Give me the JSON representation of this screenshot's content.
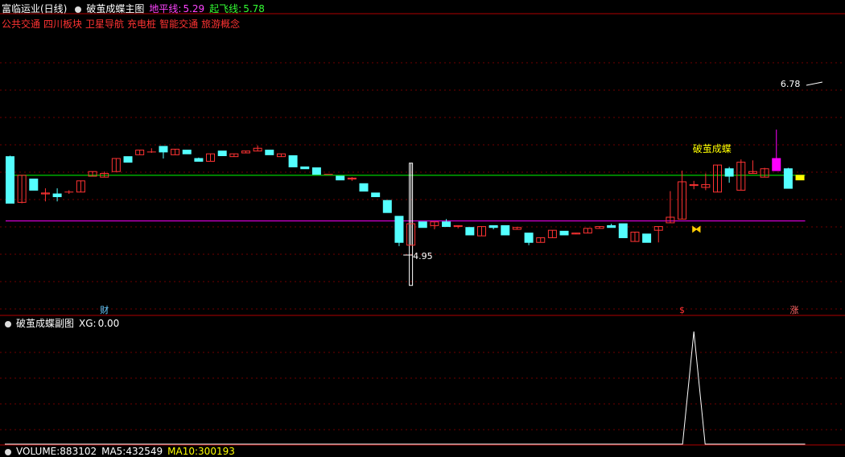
{
  "window": {
    "stock_title": "富临运业(日线)",
    "main_indicator": "破茧成蝶主图",
    "ground_line_label": "地平线:",
    "ground_line_value": "5.29",
    "takeoff_line_label": "起飞线:",
    "takeoff_line_value": "5.78"
  },
  "concepts": [
    "公共交通",
    "四川板块",
    "卫星导航",
    "充电桩",
    "智能交通",
    "旅游概念"
  ],
  "sub_panel": {
    "indicator": "破茧成蝶副图",
    "xg_label": "XG:",
    "xg_value": "0.00"
  },
  "volume_panel": {
    "volume_label": "VOLUME:",
    "volume_value": "883102",
    "ma5_label": "MA5:",
    "ma5_value": "432549",
    "ma10_label": "MA10:",
    "ma10_value": "300193"
  },
  "markers": {
    "cai": "财",
    "dollar": "$",
    "zhang": "涨"
  },
  "colors": {
    "background": "#000000",
    "up": "#ff3333",
    "down": "#54ffff",
    "ground_line": "#ff00ff",
    "takeoff_line": "#00ff00",
    "highlight_up": "#ff00ff",
    "highlight_last": "#ffff00",
    "annotation": "#ffff00",
    "panel_border": "#b00000"
  },
  "chart_data": {
    "type": "candlestick",
    "max_label": "6.78",
    "min_label": "4.95",
    "max_value": 6.78,
    "min_value": 4.95,
    "ground_line": 5.29,
    "takeoff_line": 5.78,
    "annotation_text": "破茧成蝶",
    "candles": [
      [
        5.98,
        5.48,
        5.99,
        5.48
      ],
      [
        5.49,
        5.78,
        5.78,
        5.48
      ],
      [
        5.74,
        5.62,
        5.74,
        5.62
      ],
      [
        5.58,
        5.59,
        5.64,
        5.5
      ],
      [
        5.58,
        5.55,
        5.64,
        5.5
      ],
      [
        5.6,
        5.6,
        5.62,
        5.58
      ],
      [
        5.6,
        5.72,
        5.72,
        5.6
      ],
      [
        5.77,
        5.82,
        5.82,
        5.77
      ],
      [
        5.76,
        5.8,
        5.82,
        5.76
      ],
      [
        5.82,
        5.96,
        5.96,
        5.82
      ],
      [
        5.98,
        5.92,
        5.98,
        5.92
      ],
      [
        6.0,
        6.05,
        6.05,
        6.0
      ],
      [
        6.03,
        6.03,
        6.07,
        6.02
      ],
      [
        6.09,
        6.03,
        6.09,
        5.96
      ],
      [
        6.0,
        6.06,
        6.06,
        6.0
      ],
      [
        6.05,
        6.01,
        6.05,
        6.01
      ],
      [
        5.96,
        5.93,
        5.97,
        5.93
      ],
      [
        5.93,
        6.01,
        6.01,
        5.93
      ],
      [
        6.04,
        5.99,
        6.04,
        5.99
      ],
      [
        5.98,
        6.01,
        6.01,
        5.98
      ],
      [
        6.02,
        6.04,
        6.04,
        6.02
      ],
      [
        6.04,
        6.07,
        6.1,
        6.04
      ],
      [
        6.05,
        6.0,
        6.05,
        6.0
      ],
      [
        5.98,
        6.01,
        6.01,
        5.98
      ],
      [
        5.99,
        5.87,
        5.99,
        5.87
      ],
      [
        5.87,
        5.85,
        5.87,
        5.85
      ],
      [
        5.86,
        5.79,
        5.86,
        5.79
      ],
      [
        5.79,
        5.79,
        5.79,
        5.79
      ],
      [
        5.77,
        5.73,
        5.77,
        5.73
      ],
      [
        5.74,
        5.75,
        5.76,
        5.72
      ],
      [
        5.69,
        5.61,
        5.69,
        5.61
      ],
      [
        5.59,
        5.55,
        5.59,
        5.55
      ],
      [
        5.51,
        5.38,
        5.51,
        5.38
      ],
      [
        5.34,
        5.06,
        5.34,
        5.02
      ],
      [
        5.03,
        5.26,
        5.91,
        5.03
      ],
      [
        5.28,
        5.22,
        5.28,
        5.22
      ],
      [
        5.24,
        5.28,
        5.28,
        5.2
      ],
      [
        5.28,
        5.23,
        5.31,
        5.23
      ],
      [
        5.23,
        5.24,
        5.24,
        5.21
      ],
      [
        5.22,
        5.14,
        5.22,
        5.14
      ],
      [
        5.13,
        5.23,
        5.23,
        5.13
      ],
      [
        5.24,
        5.22,
        5.24,
        5.2
      ],
      [
        5.24,
        5.14,
        5.24,
        5.14
      ],
      [
        5.2,
        5.22,
        5.22,
        5.2
      ],
      [
        5.16,
        5.06,
        5.16,
        5.03
      ],
      [
        5.06,
        5.11,
        5.11,
        5.06
      ],
      [
        5.11,
        5.19,
        5.19,
        5.11
      ],
      [
        5.18,
        5.14,
        5.18,
        5.14
      ],
      [
        5.15,
        5.16,
        5.16,
        5.15
      ],
      [
        5.16,
        5.21,
        5.21,
        5.16
      ],
      [
        5.21,
        5.23,
        5.23,
        5.21
      ],
      [
        5.24,
        5.22,
        5.26,
        5.22
      ],
      [
        5.26,
        5.11,
        5.26,
        5.11
      ],
      [
        5.07,
        5.17,
        5.17,
        5.07
      ],
      [
        5.15,
        5.06,
        5.15,
        5.06
      ],
      [
        5.19,
        5.23,
        5.23,
        5.06
      ],
      [
        5.27,
        5.33,
        5.61,
        5.27
      ],
      [
        5.31,
        5.71,
        5.83,
        5.31
      ],
      [
        5.67,
        5.68,
        5.72,
        5.63
      ],
      [
        5.65,
        5.68,
        5.8,
        5.62
      ],
      [
        5.6,
        5.89,
        5.89,
        5.6
      ],
      [
        5.85,
        5.77,
        5.87,
        5.7
      ],
      [
        5.62,
        5.92,
        5.95,
        5.62
      ],
      [
        5.8,
        5.82,
        5.94,
        5.8
      ],
      [
        5.76,
        5.85,
        5.86,
        5.76
      ],
      [
        5.83,
        5.96,
        6.27,
        5.83
      ],
      [
        5.85,
        5.64,
        5.86,
        5.64
      ],
      [
        5.78,
        5.73,
        5.78,
        5.73
      ]
    ],
    "sub_signal": {
      "peak_index": 58,
      "peak_value": 1,
      "baseline": 0
    }
  }
}
